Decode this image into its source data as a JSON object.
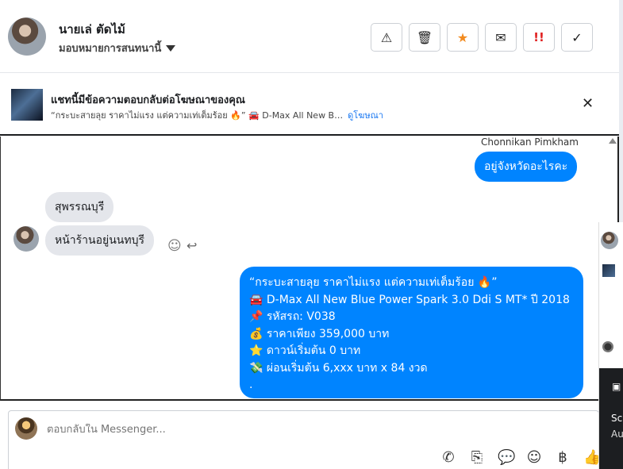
{
  "header": {
    "name": "นายเล่ ตัดไม้",
    "assign_label": "มอบหมายการสนทนานี้",
    "toolbar": {
      "report": "⚠",
      "delete": "🗑",
      "star": "★",
      "mark_unread": "✉",
      "spam": "!!",
      "done": "✓"
    }
  },
  "ad_banner": {
    "title": "แชทนี้มีข้อความตอบกลับต่อโฆษณาของคุณ",
    "subtitle": "“กระบะสายลุย ราคาไม่แรง แต่ความเท่เต็มร้อย 🔥” 🚘 D-Max All New B…",
    "link": "ดูโฆษณา",
    "close": "✕"
  },
  "thread": {
    "sender_name": "Chonnikan Pimkham",
    "messages": {
      "m1": "อยู่จังหวัดอะไรคะ",
      "m2": "สุพรรณบุรี",
      "m3": "หน้าร้านอยู่นนทบุรี",
      "m4_lines": [
        "“กระบะสายลุย ราคาไม่แรง แต่ความเท่เต็มร้อย 🔥”",
        "🚘 D-Max All New Blue Power Spark 3.0 Ddi S MT* ปี 2018",
        "📌 รหัสรถ: V038",
        "💰 ราคาเพียง 359,000 บาท",
        "⭐ ดาวน์เริ่มต้น 0 บาท",
        "💸 ผ่อนเริ่มต้น 6,xxx บาท x 84 งวด",
        "."
      ]
    },
    "react_icon": "☺",
    "reply_icon": "↩"
  },
  "composer": {
    "placeholder": "ตอบกลับใน Messenger...",
    "tools": {
      "call": "✆",
      "attach": "⎘",
      "saved_reply": "💬",
      "emoji": "☺",
      "currency": "฿",
      "like": "👍"
    }
  },
  "side_panel": {
    "text1": "Sc",
    "text2": "Au"
  }
}
